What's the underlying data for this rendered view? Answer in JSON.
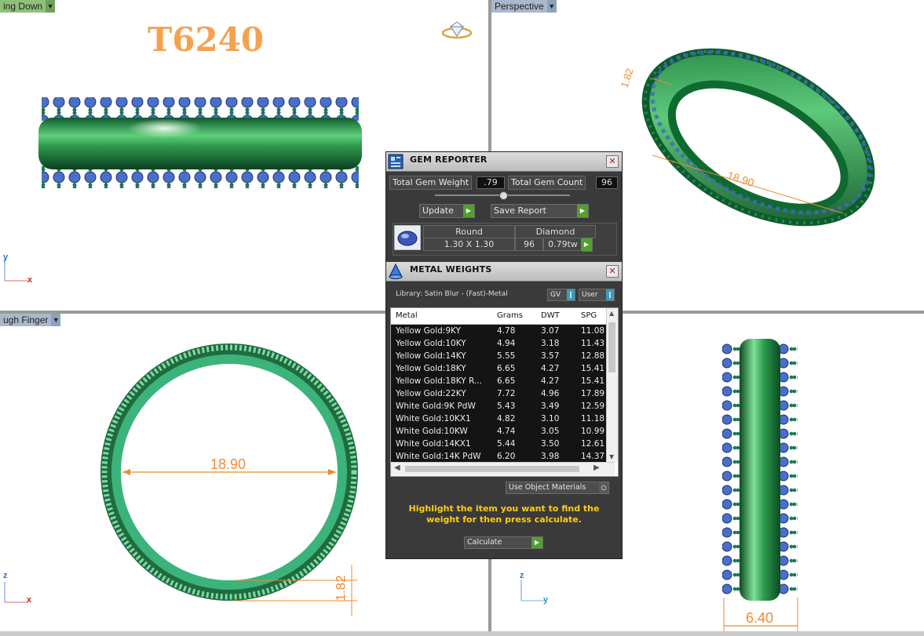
{
  "viewports": {
    "top_left": {
      "tab_label": "ing Down",
      "model_title": "T6240",
      "axis_x": "x",
      "axis_y": "y"
    },
    "top_right": {
      "tab_label": "Perspective",
      "dim_width": "1.82",
      "dim_diameter": "18.90"
    },
    "bottom_left": {
      "tab_label": "ugh Finger",
      "dim_diameter": "18.90",
      "dim_width": "1.82",
      "axis_x": "x",
      "axis_z": "z"
    },
    "bottom_right": {
      "dim_width": "6.40",
      "axis_y": "y",
      "axis_z": "z"
    }
  },
  "gem_reporter": {
    "title": "GEM REPORTER",
    "total_weight_label": "Total Gem Weight",
    "total_weight_value": ".79",
    "total_count_label": "Total Gem Count",
    "total_count_value": "96",
    "update_label": "Update",
    "save_report_label": "Save Report",
    "gem": {
      "shape": "Round",
      "material": "Diamond",
      "size": "1.30 X 1.30",
      "count": "96",
      "weight": "0.79tw"
    }
  },
  "metal_weights": {
    "title": "METAL WEIGHTS",
    "library_label": "Library: Satin Blur - (Fast)-Metal",
    "gv_label": "GV",
    "user_label": "User",
    "columns": [
      "Metal",
      "Grams",
      "DWT",
      "SPG"
    ],
    "rows": [
      [
        "Yellow Gold:9KY",
        "4.78",
        "3.07",
        "11.08"
      ],
      [
        "Yellow Gold:10KY",
        "4.94",
        "3.18",
        "11.43"
      ],
      [
        "Yellow Gold:14KY",
        "5.55",
        "3.57",
        "12.88"
      ],
      [
        "Yellow Gold:18KY",
        "6.65",
        "4.27",
        "15.41"
      ],
      [
        "Yellow Gold:18KY R...",
        "6.65",
        "4.27",
        "15.41"
      ],
      [
        "Yellow Gold:22KY",
        "7.72",
        "4.96",
        "17.89"
      ],
      [
        "White Gold:9K PdW",
        "5.43",
        "3.49",
        "12.59"
      ],
      [
        "White Gold:10KX1",
        "4.82",
        "3.10",
        "11.18"
      ],
      [
        "White Gold:10KW",
        "4.74",
        "3.05",
        "10.99"
      ],
      [
        "White Gold:14KX1",
        "5.44",
        "3.50",
        "12.61"
      ],
      [
        "White Gold:14K PdW",
        "6.20",
        "3.98",
        "14.37"
      ]
    ],
    "use_object_materials_label": "Use Object Materials",
    "hint": "Highlight the item you want to find the weight for then press calculate.",
    "calculate_label": "Calculate"
  }
}
